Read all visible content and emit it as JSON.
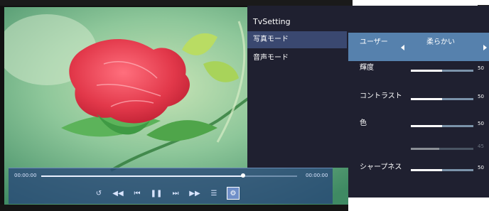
{
  "menu": {
    "title": "TvSetting",
    "items": [
      {
        "label": "写真モード",
        "active": true
      },
      {
        "label": "音声モード",
        "active": false
      }
    ]
  },
  "picture_mode": {
    "label": "ユーザー",
    "value": "柔らかい"
  },
  "settings": [
    {
      "label": "輝度",
      "value": "50",
      "level": 0.5,
      "enabled": true
    },
    {
      "label": "コントラスト",
      "value": "50",
      "level": 0.5,
      "enabled": true
    },
    {
      "label": "色",
      "value": "50",
      "level": 0.5,
      "enabled": true
    },
    {
      "label": "",
      "value": "45",
      "level": 0.45,
      "enabled": false
    },
    {
      "label": "シャープネス",
      "value": "50",
      "level": 0.5,
      "enabled": true
    }
  ],
  "player": {
    "elapsed": "00:00:00",
    "total": "00:00:00",
    "progress": 0.79,
    "controls": [
      {
        "name": "repeat-icon",
        "glyph": "↺"
      },
      {
        "name": "rewind-icon",
        "glyph": "◀◀"
      },
      {
        "name": "previous-icon",
        "glyph": "⏮"
      },
      {
        "name": "pause-icon",
        "glyph": "❚❚"
      },
      {
        "name": "next-icon",
        "glyph": "⏭"
      },
      {
        "name": "fast-forward-icon",
        "glyph": "▶▶"
      },
      {
        "name": "playlist-icon",
        "glyph": "☰"
      },
      {
        "name": "settings-icon",
        "glyph": "⚙"
      }
    ],
    "selected_control": 7
  },
  "colors": {
    "menu_bg": "#1f2030",
    "menu_active": "#3a4870",
    "selection_bar": "#5681ad",
    "player_bar": "#284678"
  }
}
